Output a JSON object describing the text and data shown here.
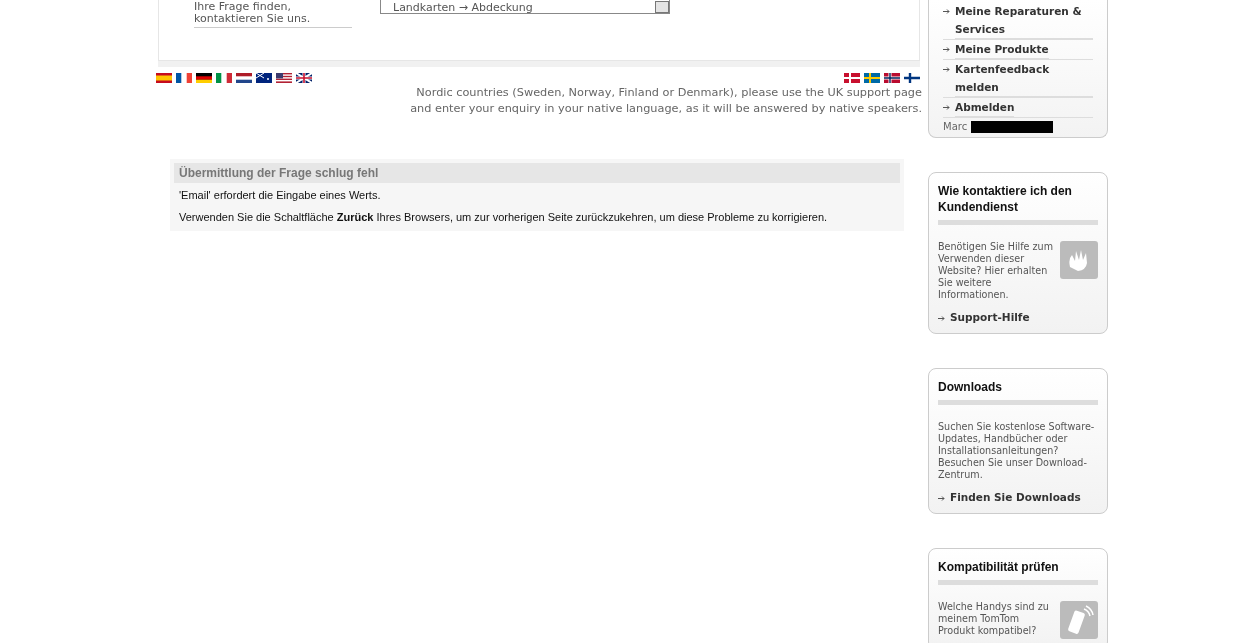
{
  "contact_form": {
    "hint": "Ihre Frage finden,\nkontaktieren Sie uns.",
    "topic_select": {
      "value": "Landkarten → Abdeckung"
    }
  },
  "flags_left": [
    {
      "kind": "es"
    },
    {
      "kind": "fr"
    },
    {
      "kind": "de"
    },
    {
      "kind": "it"
    },
    {
      "kind": "nl"
    },
    {
      "kind": "au"
    },
    {
      "kind": "us"
    },
    {
      "kind": "gb"
    }
  ],
  "flags_right": [
    {
      "kind": "dk"
    },
    {
      "kind": "se"
    },
    {
      "kind": "no"
    },
    {
      "kind": "fi"
    }
  ],
  "nordic_note": "Nordic countries (Sweden, Norway, Finland or Denmark), please use the UK support page\nand enter your enquiry in your native language, as it will be answered by native speakers.",
  "error_box": {
    "title": "Übermittlung der Frage schlug fehl",
    "message": "'Email' erfordert die Eingabe eines Werts.",
    "instruction": "Verwenden Sie die Schaltfläche **Zurück** Ihres Browsers, um zur vorherigen Seite zurückzukehren, um diese Probleme zu korrigieren."
  },
  "account_menu": {
    "items": [
      "Meine Reparaturen & Services",
      "Meine Produkte",
      "Kartenfeedback melden",
      "Abmelden"
    ],
    "user": "Marc"
  },
  "cards": [
    {
      "kind": "hand",
      "title": "Wie kontaktiere ich den Kundendienst",
      "text": "Benötigen Sie Hilfe zum Verwenden dieser Website? Hier erhalten Sie weitere Informationen.",
      "link": "Support-Hilfe"
    },
    {
      "kind": "plain",
      "title": "Downloads",
      "text": "Suchen Sie kostenlose Software-Updates, Handbücher oder Installationsanleitungen? Besuchen Sie unser Download-Zentrum.",
      "link": "Finden Sie Downloads"
    },
    {
      "kind": "phone",
      "title": "Kompatibilität prüfen",
      "text": "Welche Handys sind zu meinem TomTom Produkt kompatibel?"
    }
  ]
}
